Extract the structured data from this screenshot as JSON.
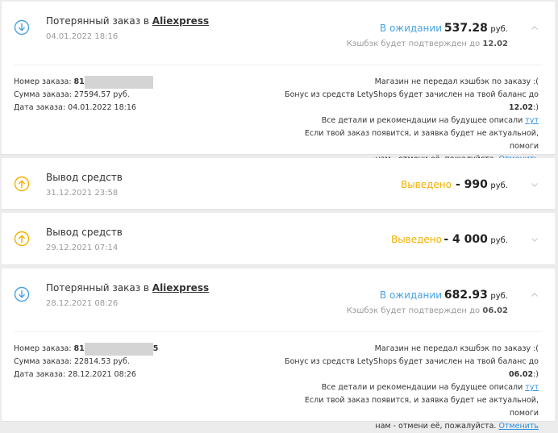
{
  "currency": "руб.",
  "colors": {
    "blue": "#4aa3e0",
    "yellow": "#f2b100",
    "link": "#2f8fe0"
  },
  "icons": {
    "pending": "arrow-down-circle-icon",
    "withdrawal": "arrow-up-circle-icon",
    "expand": "chevron-icon"
  },
  "orders": [
    {
      "title_prefix": "Потерянный заказ в ",
      "shop": "Aliexpress",
      "date": "04.01.2022 18:16",
      "status": "В ожидании",
      "amount": "537.28",
      "note_prefix": "Кэшбэк будет подтвержден до ",
      "note_date": "12.02",
      "order_label": "Номер заказа: ",
      "order_no_start": "81",
      "order_no_end": "",
      "sum_line": "Сумма заказа: 27594.57 руб.",
      "date_line": "Дата заказа: 04.01.2022 18:16",
      "msg1": "Магазин не передал кэшбэк по заказу :(",
      "msg2": "Бонус из средств LetyShops будет зачислен на твой баланс до",
      "msg2_date": "12.02",
      "msg3_prefix": "Все детали и рекомендации на будущее описали ",
      "msg3_link": "тут",
      "msg4": "Если твой заказ появится, и заявка будет не актуальной, помоги",
      "msg5_prefix": "нам - отмени её, пожалуйста. ",
      "msg5_link": "Отменить"
    },
    {
      "title_prefix": "Потерянный заказ в ",
      "shop": "Aliexpress",
      "date": "28.12.2021 08:26",
      "status": "В ожидании",
      "amount": "682.93",
      "note_prefix": "Кэшбэк будет подтвержден до ",
      "note_date": "06.02",
      "order_label": "Номер заказа: ",
      "order_no_start": "81",
      "order_no_end": "5",
      "sum_line": "Сумма заказа: 22814.53 руб.",
      "date_line": "Дата заказа: 28.12.2021 08:26",
      "msg1": "Магазин не передал кэшбэк по заказу :(",
      "msg2": "Бонус из средств LetyShops будет зачислен на твой баланс до",
      "msg2_date": "06.02",
      "msg3_prefix": "Все детали и рекомендации на будущее описали ",
      "msg3_link": "тут",
      "msg4": "Если твой заказ появится, и заявка будет не актуальной, помоги",
      "msg5_prefix": "нам - отмени её, пожалуйста. ",
      "msg5_link": "Отменить"
    }
  ],
  "withdrawals": [
    {
      "title": "Вывод средств",
      "date": "31.12.2021 23:58",
      "status": "Выведено",
      "amount": "- 990"
    },
    {
      "title": "Вывод средств",
      "date": "29.12.2021 07:14",
      "status": "Выведено",
      "amount": "- 4 000"
    }
  ]
}
